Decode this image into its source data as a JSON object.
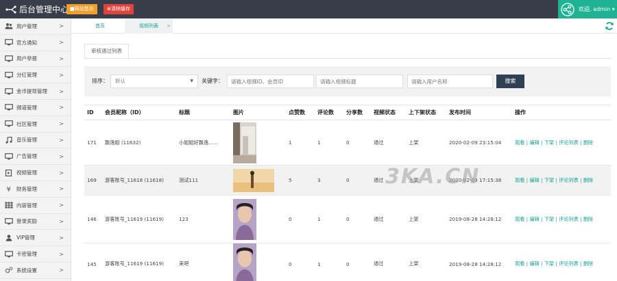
{
  "header": {
    "title": "后台管理中心",
    "btn_home": "■网站首页",
    "btn_cache": "⊗清除缓存",
    "user": "欢迎, admin ▾"
  },
  "sidebar": {
    "items": [
      {
        "label": "用户管理",
        "icon": "users-icon"
      },
      {
        "label": "官方通知",
        "icon": "monitor-icon"
      },
      {
        "label": "用户举报",
        "icon": "monitor-icon"
      },
      {
        "label": "分红管理",
        "icon": "monitor-icon"
      },
      {
        "label": "金币提现管理",
        "icon": "monitor-icon"
      },
      {
        "label": "频道管理",
        "icon": "monitor-icon"
      },
      {
        "label": "社区管理",
        "icon": "monitor-icon"
      },
      {
        "label": "音乐管理",
        "icon": "music-icon"
      },
      {
        "label": "广告管理",
        "icon": "monitor-icon"
      },
      {
        "label": "视频管理",
        "icon": "video-file-icon"
      },
      {
        "label": "财务管理",
        "icon": "yen-icon"
      },
      {
        "label": "内容管理",
        "icon": "grid-icon"
      },
      {
        "label": "登录奖励",
        "icon": "monitor-icon"
      },
      {
        "label": "VIP管理",
        "icon": "user-icon"
      },
      {
        "label": "卡密管理",
        "icon": "monitor-icon"
      },
      {
        "label": "系统设置",
        "icon": "gears-icon"
      }
    ],
    "chevron": ">"
  },
  "tabs": {
    "home": "首页",
    "video_list": "视频列表",
    "close": "×"
  },
  "subtab": "审核通过列表",
  "filter": {
    "sort_label": "排序：",
    "sort_value": "默认",
    "keyword_label": "关键字：",
    "ph_video": "请输入视频ID、会员ID",
    "ph_title": "请输入视频标题",
    "ph_user": "请输入用户名称",
    "search_btn": "搜索"
  },
  "table": {
    "headers": [
      "ID",
      "会员昵称（ID）",
      "标题",
      "图片",
      "点赞数",
      "评论数",
      "分享数",
      "视频状态",
      "上下架状态",
      "发布时间",
      "操作"
    ],
    "rows": [
      {
        "id": "171",
        "member": "飘逸姐 (11632)",
        "title": "小姐姐好飘逸......",
        "likes": "1",
        "comments": "1",
        "shares": "0",
        "status": "通过",
        "shelf": "上架",
        "time": "2020-02-09 23:15:04",
        "ops": "观看 | 编辑 | 下架 | 评论列表 | 删除"
      },
      {
        "id": "169",
        "member": "游客账号_11618 (11618)",
        "title": "测试111",
        "likes": "5",
        "comments": "3",
        "shares": "0",
        "status": "通过",
        "shelf": "上架",
        "time": "2020-02-03 17:15:38",
        "ops": "观看 | 编辑 | 下架 | 评论列表 | 删除"
      },
      {
        "id": "146",
        "member": "游客账号_11619 (11619)",
        "title": "123",
        "likes": "0",
        "comments": "1",
        "shares": "0",
        "status": "通过",
        "shelf": "上架",
        "time": "2019-08-28 14:28:12",
        "ops": "观看 | 编辑 | 下架 | 评论列表 | 删除"
      },
      {
        "id": "145",
        "member": "游客账号_11619 (11619)",
        "title": "来吧",
        "likes": "0",
        "comments": "1",
        "shares": "0",
        "status": "通过",
        "shelf": "上架",
        "time": "2019-08-28 14:28:12",
        "ops": "观看 | 编辑 | 下架 | 评论列表 | 删除"
      }
    ]
  },
  "watermark": "3KA.CN",
  "colors": {
    "topbar": "#393d49",
    "accent": "#1fb394",
    "link": "#1aa094",
    "home_btn": "#f0a02c",
    "cache_btn": "#e0433b",
    "search_btn": "#2f4056"
  }
}
